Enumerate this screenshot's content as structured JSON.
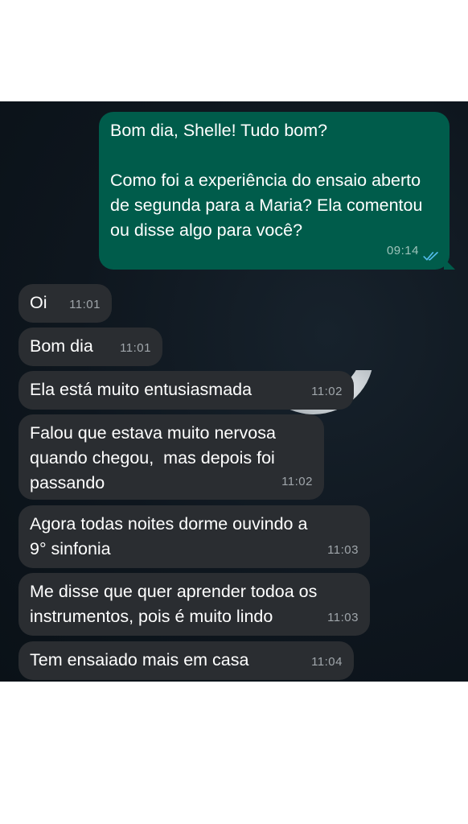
{
  "conversation": {
    "outgoing": {
      "text": "Bom dia, Shelle! Tudo bom?\n\nComo foi a experiência do ensaio aberto de segunda para a Maria? Ela comentou ou disse algo para você?",
      "time": "09:14",
      "status_icon": "double-check-read-icon",
      "status_color": "#53bdeb"
    },
    "incoming": [
      {
        "text": "Oi",
        "time": "11:01"
      },
      {
        "text": "Bom dia",
        "time": "11:01"
      },
      {
        "text": "Ela está muito entusiasmada",
        "time": "11:02"
      },
      {
        "text": "Falou que estava muito nervosa\nquando chegou,  mas depois foi\npassando",
        "time": "11:02"
      },
      {
        "text": "Agora todas noites dorme ouvindo a\n9° sinfonia",
        "time": "11:03"
      },
      {
        "text": "Me disse que quer aprender todoa os\ninstrumentos, pois é muito lindo",
        "time": "11:03"
      },
      {
        "text": "Tem ensaiado mais em casa",
        "time": "11:04"
      }
    ]
  },
  "colors": {
    "outgoing_bubble": "#005c4b",
    "incoming_bubble": "#2a2d31",
    "background": "#0e161e"
  }
}
